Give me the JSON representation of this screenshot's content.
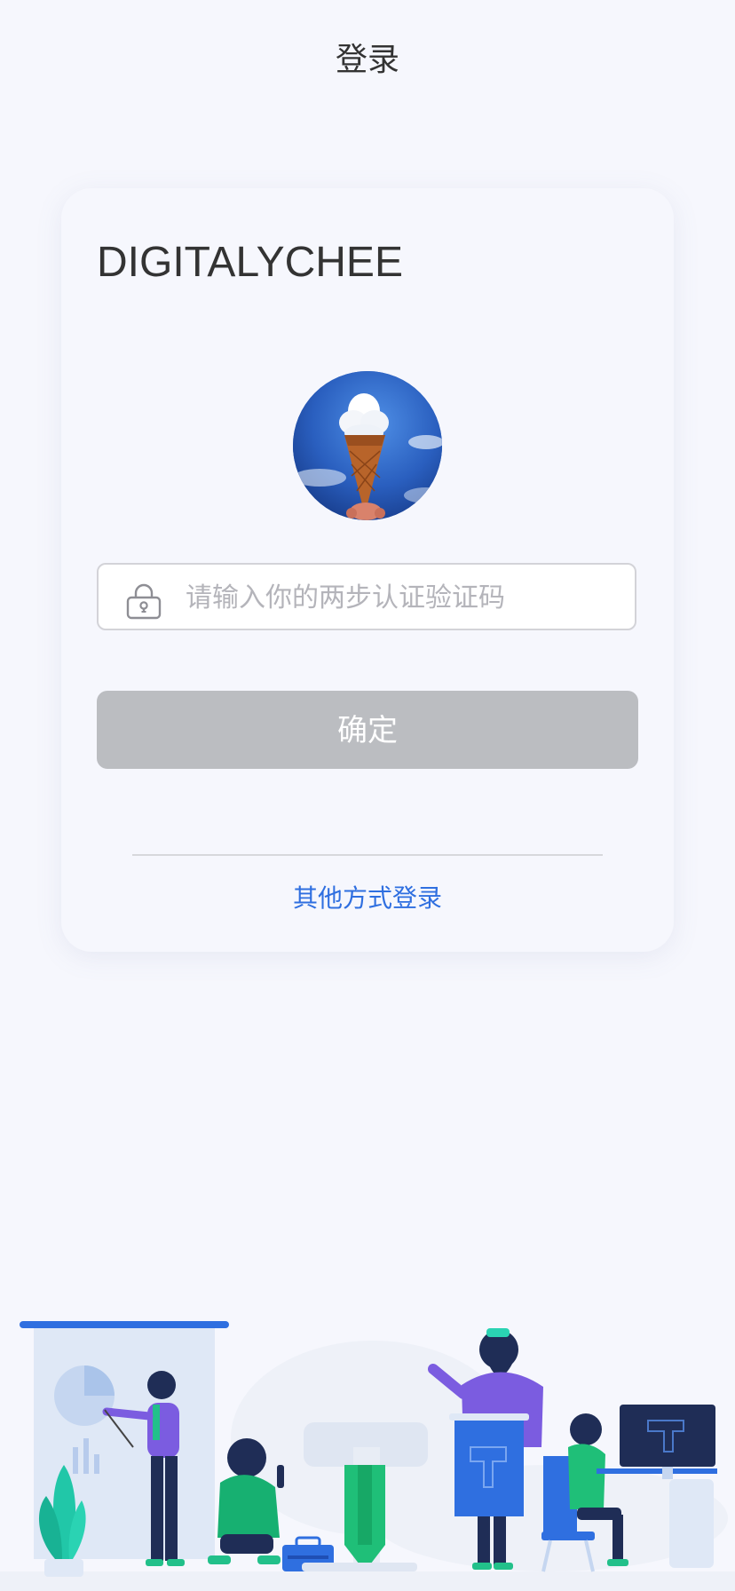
{
  "header": {
    "title": "登录"
  },
  "login_card": {
    "brand": "DIGITALYCHEE",
    "avatar_alt": "ice-cream-cloud-avatar",
    "code_input": {
      "value": "",
      "placeholder": "请输入你的两步认证验证码",
      "icon": "lock-icon"
    },
    "confirm_label": "确定",
    "other_login_label": "其他方式登录"
  },
  "colors": {
    "background": "#f6f7fd",
    "button_disabled": "#bbbdc1",
    "link": "#2f6fe0",
    "accent": "#2f6fe0"
  },
  "illustration": {
    "icon": "team-working-illustration"
  }
}
